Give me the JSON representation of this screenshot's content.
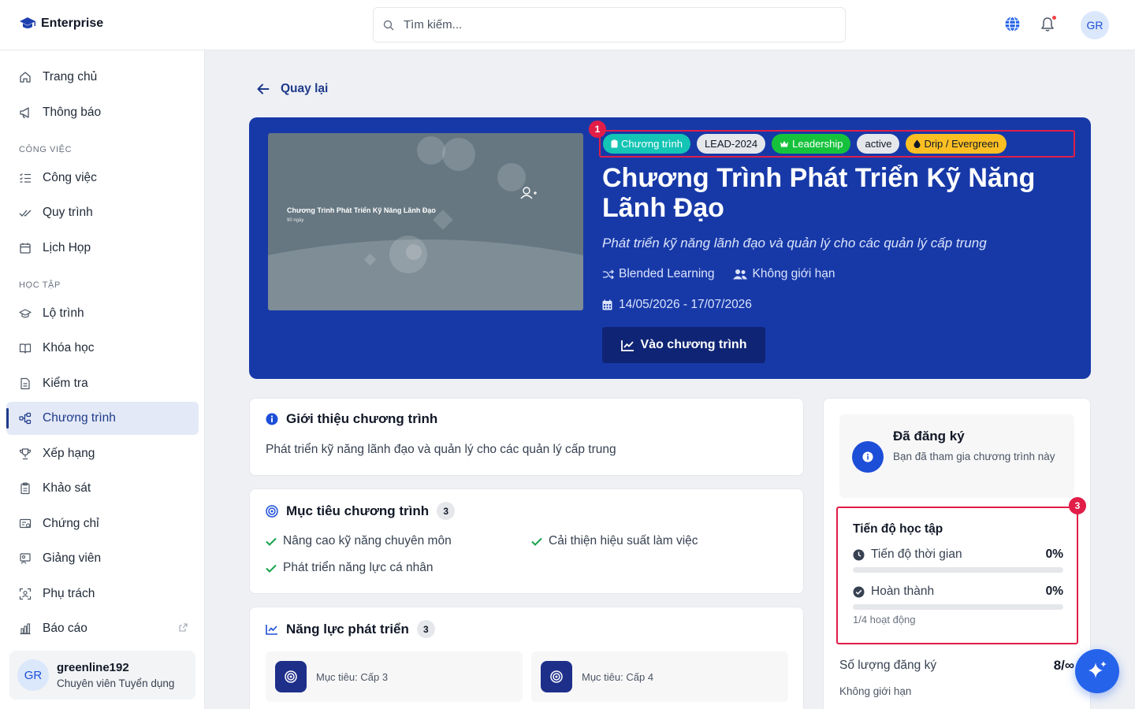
{
  "header": {
    "brand": "Enterprise",
    "search_placeholder": "Tìm kiếm...",
    "avatar_initials": "GR"
  },
  "sidebar": {
    "items": [
      {
        "label": "Trang chủ",
        "icon": "home-icon"
      },
      {
        "label": "Thông báo",
        "icon": "megaphone-icon"
      },
      {
        "label": "Công việc",
        "icon": "checklist-icon"
      },
      {
        "label": "Quy trình",
        "icon": "double-check-icon"
      },
      {
        "label": "Lịch Họp",
        "icon": "calendar-icon"
      },
      {
        "label": "Lộ trình",
        "icon": "graduation-cap-icon"
      },
      {
        "label": "Khóa học",
        "icon": "book-icon"
      },
      {
        "label": "Kiểm tra",
        "icon": "document-icon"
      },
      {
        "label": "Chương trình",
        "icon": "program-icon",
        "active": true
      },
      {
        "label": "Xếp hạng",
        "icon": "trophy-icon"
      },
      {
        "label": "Khảo sát",
        "icon": "clipboard-icon"
      },
      {
        "label": "Chứng chỉ",
        "icon": "certificate-icon"
      },
      {
        "label": "Giảng viên",
        "icon": "instructor-icon"
      },
      {
        "label": "Phụ trách",
        "icon": "person-focus-icon"
      },
      {
        "label": "Báo cáo",
        "icon": "bar-chart-icon"
      }
    ],
    "sections": {
      "work": "CÔNG VIỆC",
      "learning": "HỌC TẬP"
    },
    "user": {
      "initials": "GR",
      "name": "greenline192",
      "role": "Chuyên viên Tuyển dụng"
    }
  },
  "main": {
    "back_label": "Quay lại",
    "hero": {
      "thumb_title": "Chương Trình Phát Triển Kỹ Năng Lãnh Đạo",
      "thumb_sub": "90 ngày",
      "tags": {
        "type": "Chương trình",
        "code": "LEAD-2024",
        "category": "Leadership",
        "status": "active",
        "mode": "Drip / Evergreen"
      },
      "marker": "1",
      "title": "Chương Trình Phát Triển Kỹ Năng Lãnh Đạo",
      "description": "Phát triển kỹ năng lãnh đạo và quản lý cho các quản lý cấp trung",
      "format": "Blended Learning",
      "capacity": "Không giới hạn",
      "dates": "14/05/2026 - 17/07/2026",
      "cta": "Vào chương trình"
    },
    "intro": {
      "title": "Giới thiệu chương trình",
      "text": "Phát triển kỹ năng lãnh đạo và quản lý cho các quản lý cấp trung"
    },
    "goals": {
      "title": "Mục tiêu chương trình",
      "count": "3",
      "items": [
        "Nâng cao kỹ năng chuyên môn",
        "Cải thiện hiệu suất làm việc",
        "Phát triển năng lực cá nhân"
      ]
    },
    "competencies": {
      "title": "Năng lực phát triển",
      "count": "3",
      "items": [
        "Mục tiêu: Cấp 3",
        "Mục tiêu: Cấp 4"
      ]
    }
  },
  "side": {
    "registered_title": "Đã đăng ký",
    "registered_sub": "Bạn đã tham gia chương trình này",
    "progress": {
      "marker": "3",
      "title": "Tiến độ học tập",
      "time_label": "Tiến độ thời gian",
      "time_pct": "0%",
      "time_value": 0,
      "done_label": "Hoàn thành",
      "done_pct": "0%",
      "done_value": 0,
      "activities": "1/4 hoạt động"
    },
    "reg_count_label": "Số lượng đăng ký",
    "reg_count_value": "8/∞",
    "reg_limit": "Không giới hạn"
  },
  "colors": {
    "hero_bg": "#1739a8",
    "primary": "#1e3a8a",
    "marker": "#e11d48",
    "tag_teal": "#14c4b4",
    "tag_green": "#16c23c",
    "tag_yellow": "#fbbf24"
  }
}
